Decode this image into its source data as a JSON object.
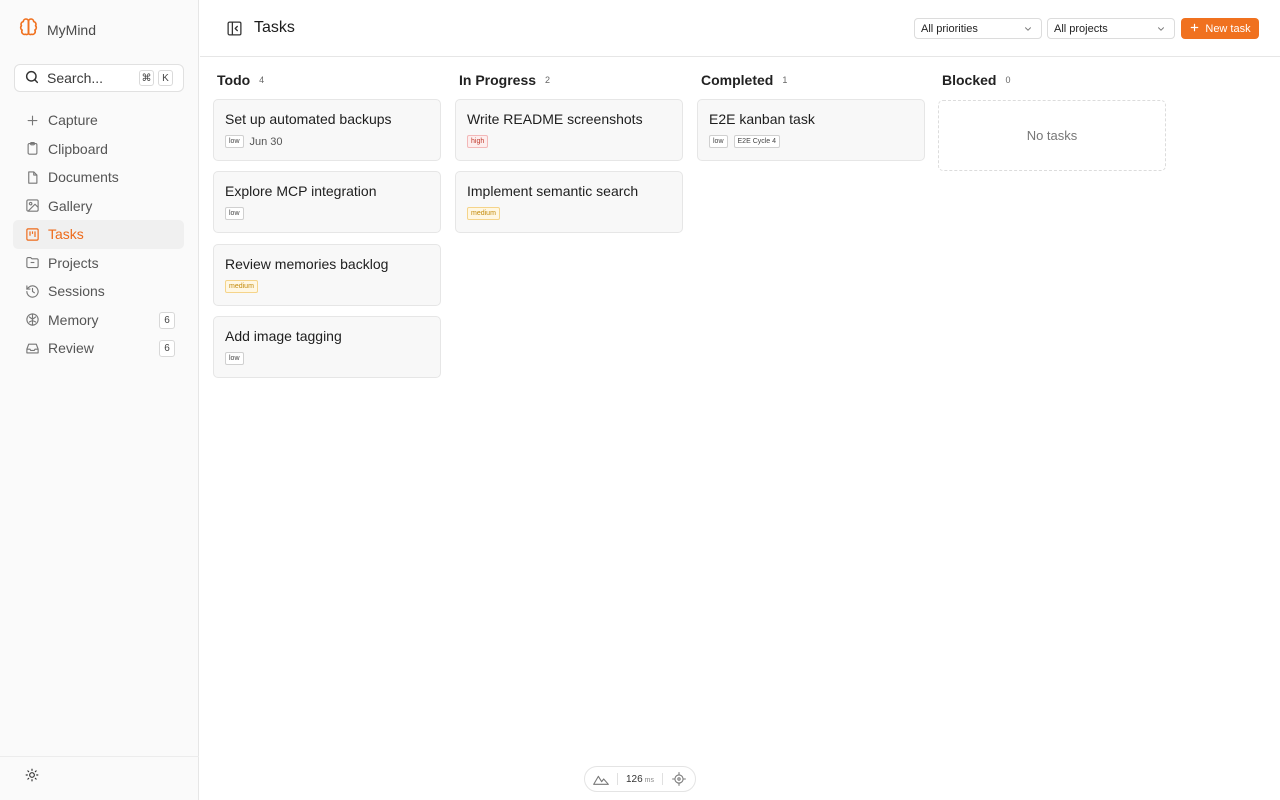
{
  "app": {
    "name": "MyMind"
  },
  "search": {
    "label": "Search...",
    "shortcut_mod": "⌘",
    "shortcut_key": "K"
  },
  "sidebar": {
    "items": [
      {
        "label": "Capture",
        "icon": "plus-icon"
      },
      {
        "label": "Clipboard",
        "icon": "clipboard-icon"
      },
      {
        "label": "Documents",
        "icon": "documents-icon"
      },
      {
        "label": "Gallery",
        "icon": "image-icon"
      },
      {
        "label": "Tasks",
        "icon": "kanban-icon",
        "active": true
      },
      {
        "label": "Projects",
        "icon": "folder-icon"
      },
      {
        "label": "Sessions",
        "icon": "history-icon"
      },
      {
        "label": "Memory",
        "icon": "brain-icon",
        "badge": "6"
      },
      {
        "label": "Review",
        "icon": "inbox-icon",
        "badge": "6"
      }
    ]
  },
  "header": {
    "title": "Tasks",
    "priority_filter": "All priorities",
    "project_filter": "All projects",
    "new_task_label": "New task"
  },
  "columns": [
    {
      "title": "Todo",
      "count": "4",
      "cards": [
        {
          "title": "Set up automated backups",
          "priority": "low",
          "due": "Jun 30"
        },
        {
          "title": "Explore MCP integration",
          "priority": "low"
        },
        {
          "title": "Review memories backlog",
          "priority": "medium"
        },
        {
          "title": "Add image tagging",
          "priority": "low"
        }
      ]
    },
    {
      "title": "In Progress",
      "count": "2",
      "cards": [
        {
          "title": "Write README screenshots",
          "priority": "high"
        },
        {
          "title": "Implement semantic search",
          "priority": "medium"
        }
      ]
    },
    {
      "title": "Completed",
      "count": "1",
      "cards": [
        {
          "title": "E2E kanban task",
          "priority": "low",
          "project": "E2E Cycle 4"
        }
      ]
    },
    {
      "title": "Blocked",
      "count": "0",
      "empty_text": "No tasks",
      "cards": []
    }
  ],
  "footer": {
    "latency_value": "126",
    "latency_unit": "ms"
  },
  "colors": {
    "accent": "#f0711f",
    "high": "#c0392b",
    "medium": "#c38a0a"
  }
}
